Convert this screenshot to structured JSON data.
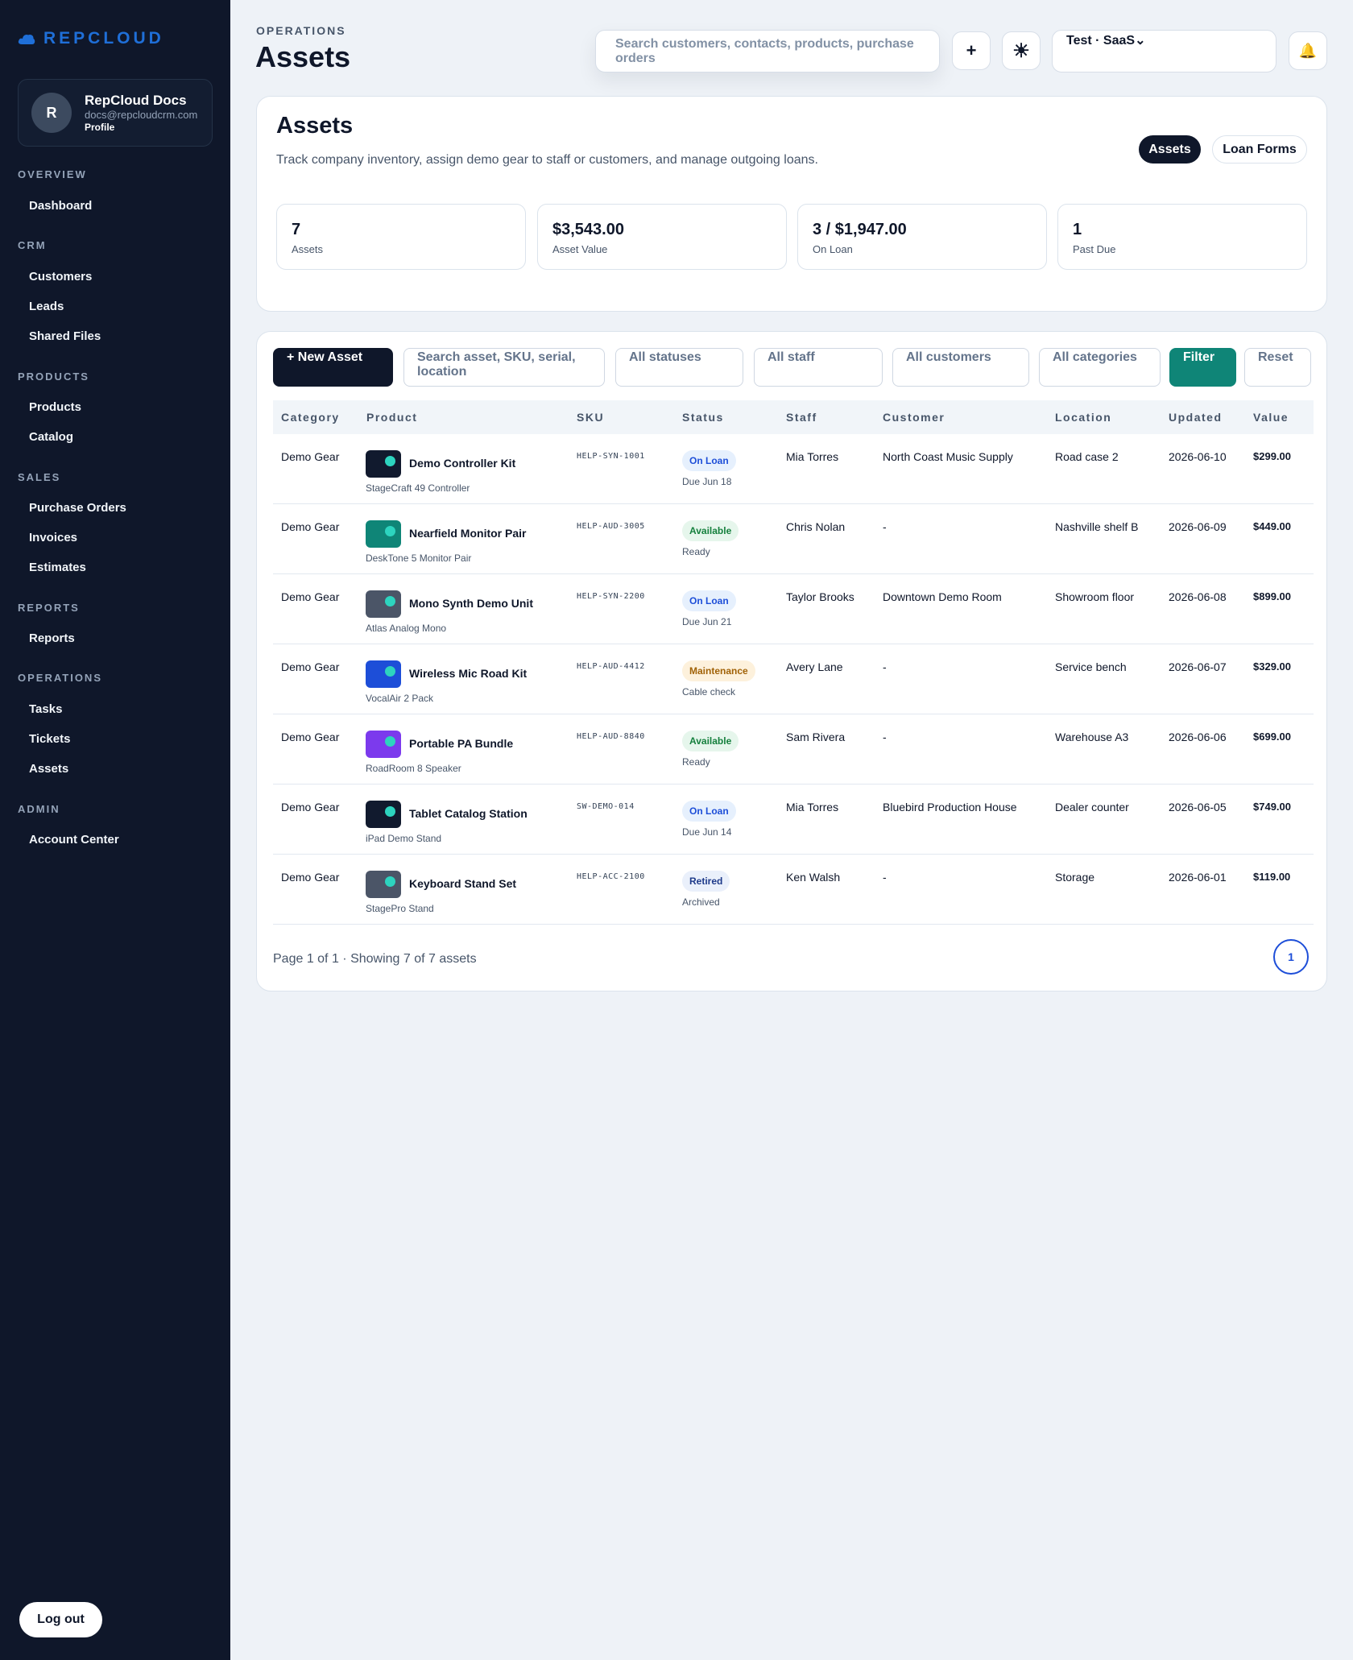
{
  "brand": {
    "name": "REPCLOUD"
  },
  "profile": {
    "initial": "R",
    "name": "RepCloud Docs",
    "email": "docs@repcloudcrm.com",
    "link": "Profile"
  },
  "nav": {
    "overview": "OVERVIEW",
    "dashboard": "Dashboard",
    "crm": "CRM",
    "customers": "Customers",
    "leads": "Leads",
    "shared_files": "Shared Files",
    "products": "PRODUCTS",
    "products_item": "Products",
    "catalog": "Catalog",
    "sales": "SALES",
    "purchase_orders": "Purchase Orders",
    "invoices": "Invoices",
    "estimates": "Estimates",
    "reports": "REPORTS",
    "reports_item": "Reports",
    "operations": "OPERATIONS",
    "tasks": "Tasks",
    "tickets": "Tickets",
    "assets": "Assets",
    "admin": "ADMIN",
    "account_center": "Account Center"
  },
  "logout": "Log out",
  "header": {
    "eyebrow": "OPERATIONS",
    "title": "Assets",
    "search_placeholder": "Search customers, contacts, products, purchase orders",
    "add_icon": "+",
    "theme_icon": "☀",
    "workspace": "Test · SaaS",
    "workspace_chevron": "⌄",
    "bell_icon": "🔔"
  },
  "summary": {
    "title": "Assets",
    "description": "Track company inventory, assign demo gear to staff or customers, and manage outgoing loans.",
    "tabs": {
      "assets": "Assets",
      "loan_forms": "Loan Forms"
    },
    "stats": [
      {
        "value": "7",
        "label": "Assets"
      },
      {
        "value": "$3,543.00",
        "label": "Asset Value"
      },
      {
        "value": "3 / $1,947.00",
        "label": "On Loan"
      },
      {
        "value": "1",
        "label": "Past Due"
      }
    ]
  },
  "filters": {
    "new_asset": "+ New Asset",
    "search_placeholder": "Search asset, SKU, serial, location",
    "statuses": "All statuses",
    "staff": "All staff",
    "customers": "All customers",
    "categories": "All categories",
    "filter": "Filter",
    "reset": "Reset"
  },
  "table": {
    "columns": {
      "category": "Category",
      "product": "Product",
      "sku": "SKU",
      "status": "Status",
      "staff": "Staff",
      "customer": "Customer",
      "location": "Location",
      "updated": "Updated",
      "value": "Value"
    },
    "rows": [
      {
        "category": "Demo Gear",
        "name": "Demo Controller Kit",
        "sub": "StageCraft 49 Controller",
        "sku": "HELP-SYN-1001",
        "status": "On Loan",
        "status_sub": "Due Jun 18",
        "staff": "Mia Torres",
        "customer": "North Coast Music Supply",
        "location": "Road case 2",
        "updated": "2026-06-10",
        "value": "$299.00"
      },
      {
        "category": "Demo Gear",
        "name": "Nearfield Monitor Pair",
        "sub": "DeskTone 5 Monitor Pair",
        "sku": "HELP-AUD-3005",
        "status": "Available",
        "status_sub": "Ready",
        "staff": "Chris Nolan",
        "customer": "-",
        "location": "Nashville shelf B",
        "updated": "2026-06-09",
        "value": "$449.00"
      },
      {
        "category": "Demo Gear",
        "name": "Mono Synth Demo Unit",
        "sub": "Atlas Analog Mono",
        "sku": "HELP-SYN-2200",
        "status": "On Loan",
        "status_sub": "Due Jun 21",
        "staff": "Taylor Brooks",
        "customer": "Downtown Demo Room",
        "location": "Showroom floor",
        "updated": "2026-06-08",
        "value": "$899.00"
      },
      {
        "category": "Demo Gear",
        "name": "Wireless Mic Road Kit",
        "sub": "VocalAir 2 Pack",
        "sku": "HELP-AUD-4412",
        "status": "Maintenance",
        "status_sub": "Cable check",
        "staff": "Avery Lane",
        "customer": "-",
        "location": "Service bench",
        "updated": "2026-06-07",
        "value": "$329.00"
      },
      {
        "category": "Demo Gear",
        "name": "Portable PA Bundle",
        "sub": "RoadRoom 8 Speaker",
        "sku": "HELP-AUD-8840",
        "status": "Available",
        "status_sub": "Ready",
        "staff": "Sam Rivera",
        "customer": "-",
        "location": "Warehouse A3",
        "updated": "2026-06-06",
        "value": "$699.00"
      },
      {
        "category": "Demo Gear",
        "name": "Tablet Catalog Station",
        "sub": "iPad Demo Stand",
        "sku": "SW-DEMO-014",
        "status": "On Loan",
        "status_sub": "Due Jun 14",
        "staff": "Mia Torres",
        "customer": "Bluebird Production House",
        "location": "Dealer counter",
        "updated": "2026-06-05",
        "value": "$749.00"
      },
      {
        "category": "Demo Gear",
        "name": "Keyboard Stand Set",
        "sub": "StagePro Stand",
        "sku": "HELP-ACC-2100",
        "status": "Retired",
        "status_sub": "Archived",
        "staff": "Ken Walsh",
        "customer": "-",
        "location": "Storage",
        "updated": "2026-06-01",
        "value": "$119.00"
      }
    ]
  },
  "pager": {
    "text": "Page 1 of 1 · Showing 7 of 7 assets",
    "current": "1"
  },
  "colors": {
    "sidebar": "#0f172a",
    "brand": "#1f6fd8",
    "accent_teal": "#0f8577",
    "thumb_dark": "#111a2e",
    "thumb_teal": "#0f8577",
    "thumb_slate": "#4b5567",
    "thumb_blue": "#1d4ed8",
    "thumb_purple": "#7c3aed"
  }
}
